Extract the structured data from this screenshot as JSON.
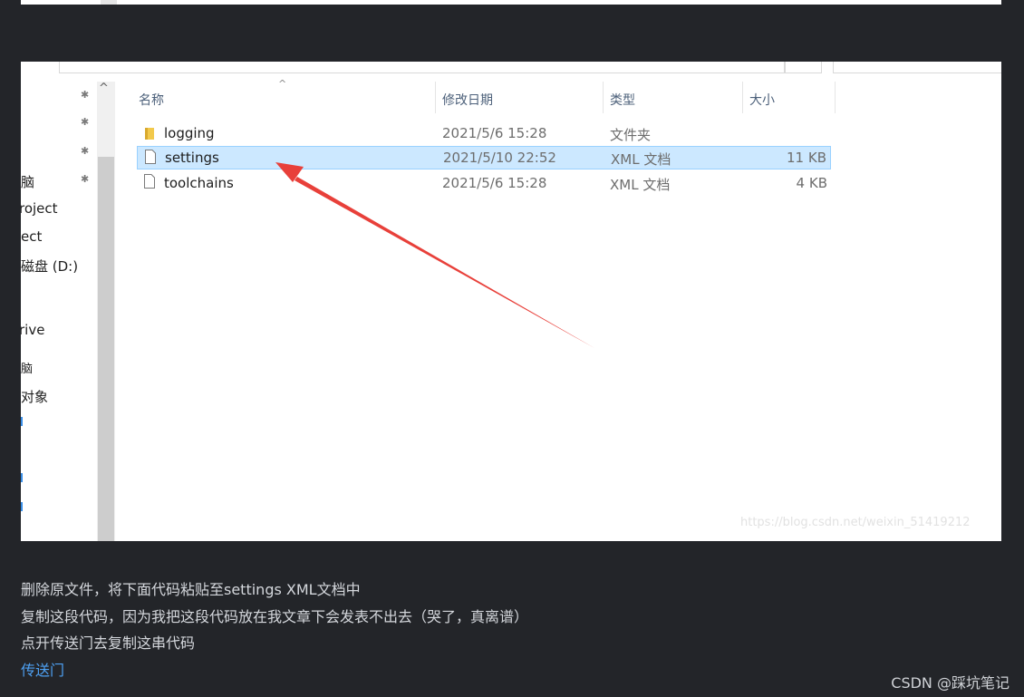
{
  "explorer": {
    "nav_items": [
      {
        "label": "脑"
      },
      {
        "label": "roject"
      },
      {
        "label": "ect"
      },
      {
        "label": "磁盘 (D:)"
      },
      {
        "label": "rive"
      },
      {
        "label": "脑"
      },
      {
        "label": "对象"
      }
    ],
    "columns": {
      "name": "名称",
      "modified": "修改日期",
      "type": "类型",
      "size": "大小"
    },
    "files": [
      {
        "name": "logging",
        "modified": "2021/5/6 15:28",
        "type": "文件夹",
        "size": "",
        "icon": "folder-icon",
        "selected": false
      },
      {
        "name": "settings",
        "modified": "2021/5/10 22:52",
        "type": "XML 文档",
        "size": "11 KB",
        "icon": "file-icon",
        "selected": true
      },
      {
        "name": "toolchains",
        "modified": "2021/5/6 15:28",
        "type": "XML 文档",
        "size": "4 KB",
        "icon": "file-icon",
        "selected": false
      }
    ],
    "watermark": "https://blog.csdn.net/weixin_51419212"
  },
  "article": {
    "line1": "删除原文件，将下面代码粘贴至settings XML文档中",
    "line2": "复制这段代码，因为我把这段代码放在我文章下会发表不出去（哭了，真离谱）",
    "line3": "点开传送门去复制这串代码",
    "link": "传送门"
  },
  "footer": {
    "brand": "CSDN @踩坑笔记"
  },
  "colors": {
    "accent_link": "#4ea1f3",
    "selection": "#cce8ff",
    "arrow": "#e8403a",
    "page_bg": "#232529"
  }
}
